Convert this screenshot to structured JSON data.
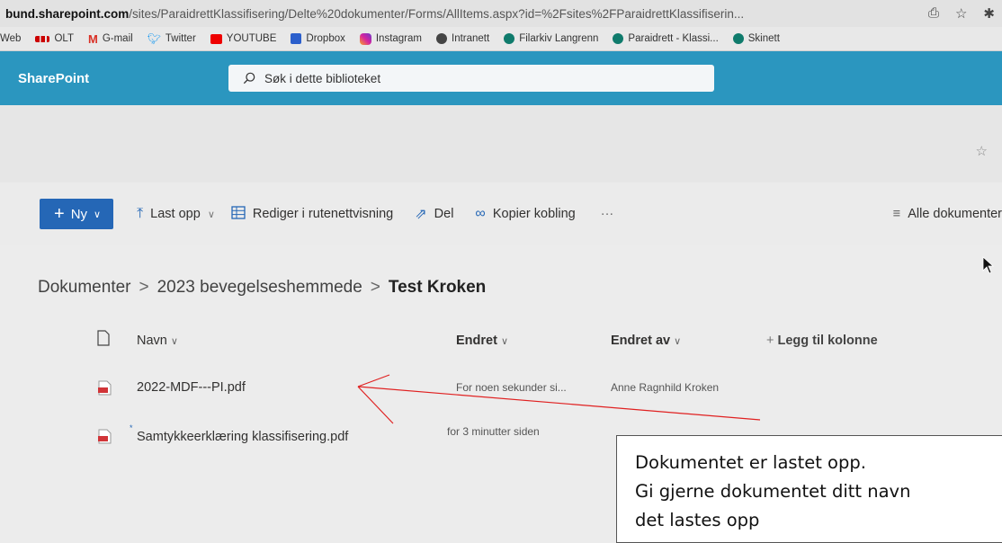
{
  "browser": {
    "url_host": "bund.sharepoint.com",
    "url_path": "/sites/ParaidrettKlassifisering/Delte%20dokumenter/Forms/AllItems.aspx?id=%2Fsites%2FParaidrettKlassifiserin...",
    "bookmarks": [
      "Web",
      "OLT",
      "G-mail",
      "Twitter",
      "YOUTUBE",
      "Dropbox",
      "Instagram",
      "Intranett",
      "Filarkiv Langrenn",
      "Paraidrett - Klassi...",
      "Skinett"
    ]
  },
  "sharepoint": {
    "brand": "SharePoint",
    "search_placeholder": "Søk i dette biblioteket"
  },
  "command_bar": {
    "new_label": "Ny",
    "upload_label": "Last opp",
    "grid_edit_label": "Rediger i rutenettvisning",
    "share_label": "Del",
    "copy_link_label": "Kopier kobling",
    "more_label": "···",
    "view_label": "Alle dokumenter"
  },
  "breadcrumb": {
    "items": [
      "Dokumenter",
      "2023 bevegelseshemmede"
    ],
    "separator": ">",
    "current": "Test Kroken"
  },
  "table": {
    "columns": {
      "name": "Navn",
      "modified": "Endret",
      "modified_by": "Endret av",
      "add_column": "Legg til kolonne"
    },
    "rows": [
      {
        "name": "2022-MDF---PI.pdf",
        "modified": "For noen sekunder si...",
        "modified_by": "Anne Ragnhild Kroken"
      },
      {
        "name": "Samtykkeerklæring klassifisering.pdf",
        "modified": "for 3 minutter siden",
        "modified_by": ""
      }
    ]
  },
  "annotation": {
    "line1": "Dokumentet er lastet opp.",
    "line2": "Gi gjerne dokumentet ditt navn",
    "line3": "det lastes opp"
  },
  "colors": {
    "sharepoint_header": "#2b96bf",
    "new_button": "#2567b6",
    "annotation_arrow": "#e02020"
  }
}
